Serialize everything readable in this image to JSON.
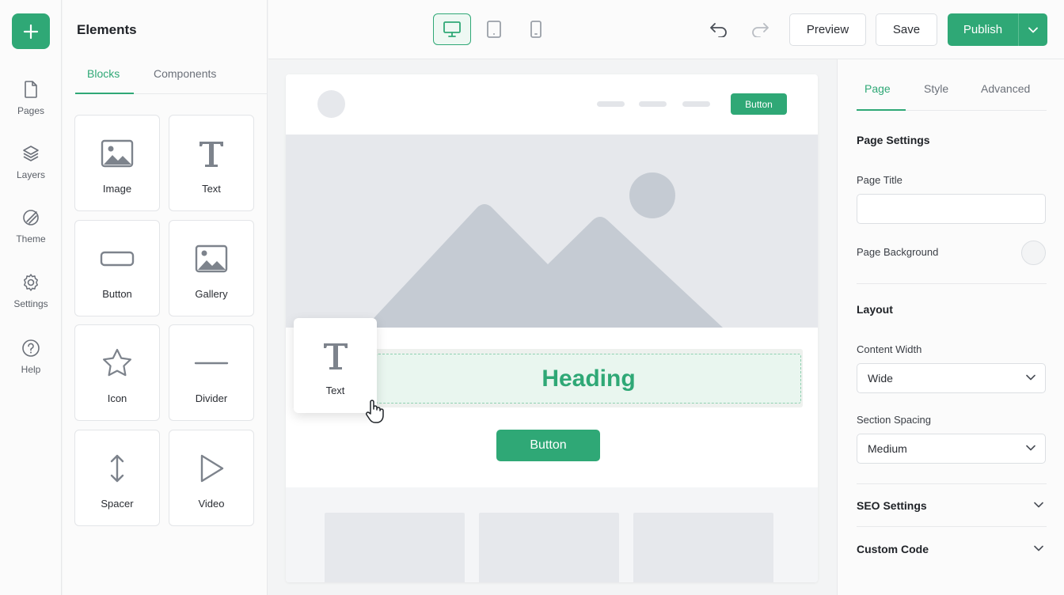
{
  "rail": {
    "add_label": "+",
    "items": [
      {
        "label": "Pages",
        "icon": "page-icon"
      },
      {
        "label": "Layers",
        "icon": "layers-icon"
      },
      {
        "label": "Theme",
        "icon": "palette-icon"
      },
      {
        "label": "Settings",
        "icon": "gear-icon"
      },
      {
        "label": "Help",
        "icon": "help-icon"
      }
    ]
  },
  "elements_panel": {
    "title": "Elements",
    "tabs": [
      {
        "label": "Blocks",
        "active": true
      },
      {
        "label": "Components",
        "active": false
      }
    ],
    "blocks": [
      {
        "label": "Image",
        "icon": "image-icon"
      },
      {
        "label": "Text",
        "icon": "text-icon"
      },
      {
        "label": "Button",
        "icon": "button-icon"
      },
      {
        "label": "Gallery",
        "icon": "gallery-icon"
      },
      {
        "label": "Icon",
        "icon": "star-icon"
      },
      {
        "label": "Divider",
        "icon": "divider-icon"
      },
      {
        "label": "Spacer",
        "icon": "spacer-icon"
      },
      {
        "label": "Video",
        "icon": "play-icon"
      }
    ]
  },
  "toolbar": {
    "devices": [
      {
        "name": "desktop",
        "icon": "desktop-icon",
        "active": true
      },
      {
        "name": "tablet",
        "icon": "tablet-icon",
        "active": false
      },
      {
        "name": "mobile",
        "icon": "mobile-icon",
        "active": false
      }
    ],
    "preview_label": "Preview",
    "save_label": "Save",
    "publish_label": "Publish"
  },
  "canvas": {
    "nav_button_label": "Button",
    "heading_text": "Heading",
    "button_label": "Button"
  },
  "drag_ghost": {
    "label": "Text",
    "icon": "text-icon"
  },
  "settings_panel": {
    "tabs": [
      {
        "label": "Page",
        "active": true
      },
      {
        "label": "Style",
        "active": false
      },
      {
        "label": "Advanced",
        "active": false
      }
    ],
    "page_settings_title": "Page Settings",
    "page_title_label": "Page Title",
    "page_title_value": "",
    "page_background_label": "Page Background",
    "layout_title": "Layout",
    "content_width_label": "Content Width",
    "content_width_value": "Wide",
    "section_spacing_label": "Section Spacing",
    "section_spacing_value": "Medium",
    "seo_label": "SEO Settings",
    "custom_code_label": "Custom Code"
  },
  "colors": {
    "accent": "#2fa876",
    "canvas_placeholder": "#e6e8ec",
    "placeholder_shape": "#c5cbd3"
  }
}
